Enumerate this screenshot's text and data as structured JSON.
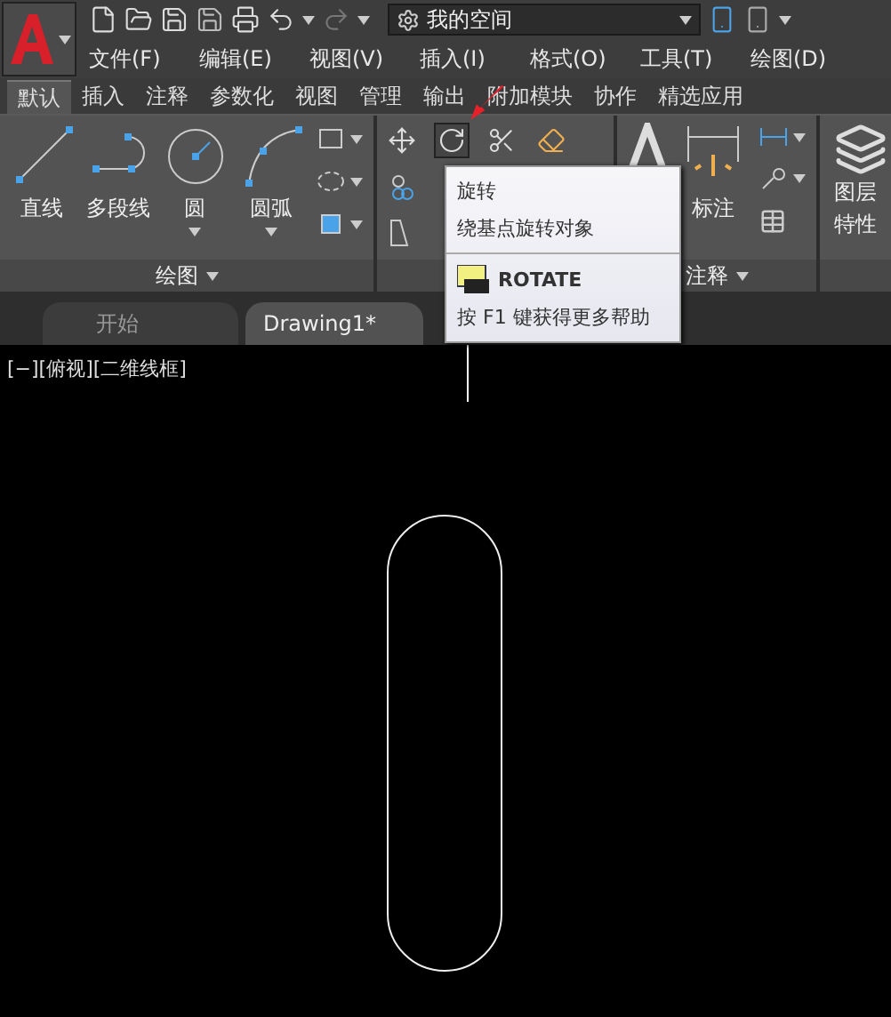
{
  "title_bar": {
    "workspace": "我的空间"
  },
  "menu_bar": [
    "文件(F)",
    "编辑(E)",
    "视图(V)",
    "插入(I)",
    "格式(O)",
    "工具(T)",
    "绘图(D)"
  ],
  "ribbon_tabs": [
    {
      "label": "默认",
      "selected": true
    },
    {
      "label": "插入",
      "selected": false
    },
    {
      "label": "注释",
      "selected": false
    },
    {
      "label": "参数化",
      "selected": false
    },
    {
      "label": "视图",
      "selected": false
    },
    {
      "label": "管理",
      "selected": false
    },
    {
      "label": "输出",
      "selected": false
    },
    {
      "label": "附加模块",
      "selected": false
    },
    {
      "label": "协作",
      "selected": false
    },
    {
      "label": "精选应用",
      "selected": false
    }
  ],
  "draw_panel": {
    "title": "绘图",
    "tools": [
      {
        "label": "直线",
        "kind": "line"
      },
      {
        "label": "多段线",
        "kind": "polyline"
      },
      {
        "label": "圆",
        "kind": "circle"
      },
      {
        "label": "圆弧",
        "kind": "arc"
      }
    ]
  },
  "modify_panel": {
    "tools": [
      {
        "kind": "move",
        "selected": false
      },
      {
        "kind": "rotate",
        "selected": true
      },
      {
        "kind": "trim",
        "selected": false
      },
      {
        "kind": "erase",
        "selected": false
      }
    ]
  },
  "annotation_panel": {
    "title": "注释",
    "tools": [
      {
        "label": "标注"
      }
    ]
  },
  "layers_panel": {
    "label_lines": [
      "图层",
      "特性"
    ]
  },
  "doc_tabs": [
    {
      "label": "开始",
      "selected": false
    },
    {
      "label": "Drawing1*",
      "selected": true
    }
  ],
  "viewport_label": "[−][俯视][二维线框]",
  "tooltip": {
    "title": "旋转",
    "description": "绕基点旋转对象",
    "command": "ROTATE",
    "help": "按 F1 键获得更多帮助"
  }
}
